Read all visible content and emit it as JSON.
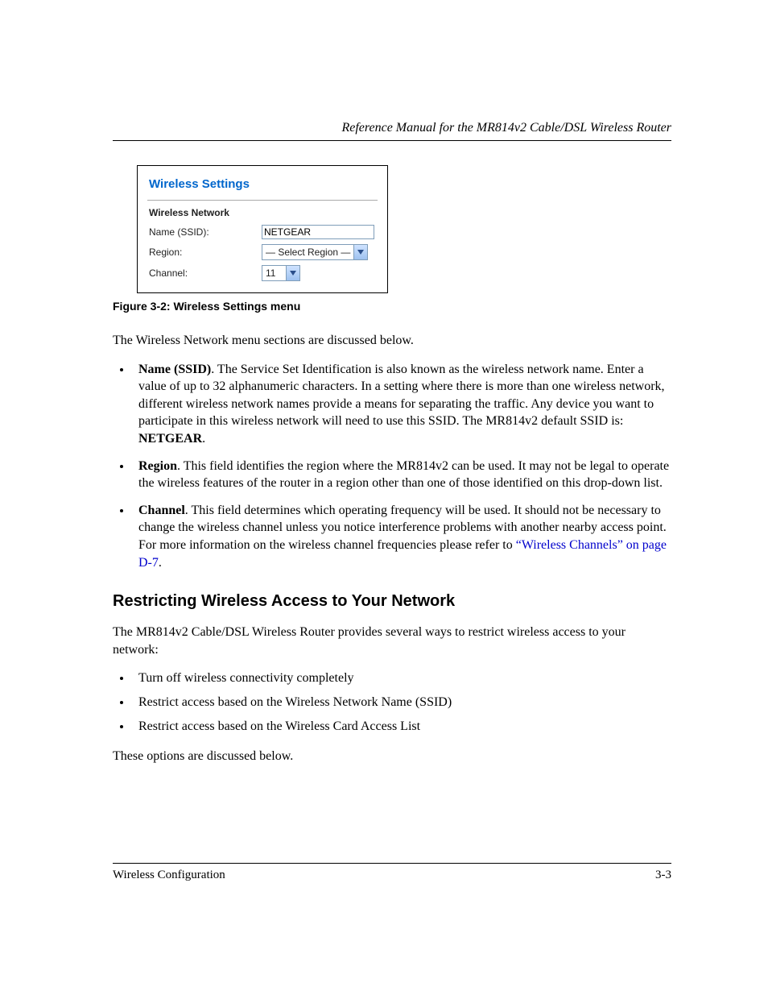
{
  "header": {
    "running_title": "Reference Manual for the MR814v2 Cable/DSL Wireless Router"
  },
  "figure": {
    "panel_title": "Wireless Settings",
    "section_label": "Wireless Network",
    "rows": {
      "name_label": "Name (SSID):",
      "name_value": "NETGEAR",
      "region_label": "Region:",
      "region_value": "— Select Region —",
      "channel_label": "Channel:",
      "channel_value": "11"
    },
    "caption": "Figure 3-2:  Wireless Settings menu"
  },
  "body": {
    "intro": "The Wireless Network menu sections are discussed below.",
    "bullets": {
      "ssid_label": "Name (SSID)",
      "ssid_text_1": ". The Service Set Identification is also known as the wireless network name. Enter a value of up to 32 alphanumeric characters. In a setting where there is more than one wireless network, different wireless network names provide a means for separating the traffic. Any device you want to participate in this wireless network will need to use this SSID. The MR814v2 default SSID is: ",
      "ssid_default": "NETGEAR",
      "ssid_period": ".",
      "region_label": "Region",
      "region_text": ". This field identifies the region where the MR814v2 can be used. It may not be legal to operate the wireless features of the router in a region other than one of those identified on this drop-down list.",
      "channel_label": "Channel",
      "channel_text_1": ". This field determines which operating frequency will be used. It should not be necessary to change the wireless channel unless you notice interference problems with another nearby access point. For more information on the wireless channel frequencies please refer to ",
      "channel_link": "“Wireless Channels” on page D-7",
      "channel_period": "."
    },
    "section_heading": "Restricting Wireless Access to Your Network",
    "restrict_intro": "The MR814v2 Cable/DSL Wireless Router provides several ways to restrict wireless access to your network:",
    "restrict_items": {
      "a": "Turn off wireless connectivity completely",
      "b": "Restrict access based on the Wireless Network Name (SSID)",
      "c": "Restrict access based on the Wireless Card Access List"
    },
    "restrict_outro": "These options are discussed below."
  },
  "footer": {
    "section": "Wireless Configuration",
    "page": "3-3"
  }
}
